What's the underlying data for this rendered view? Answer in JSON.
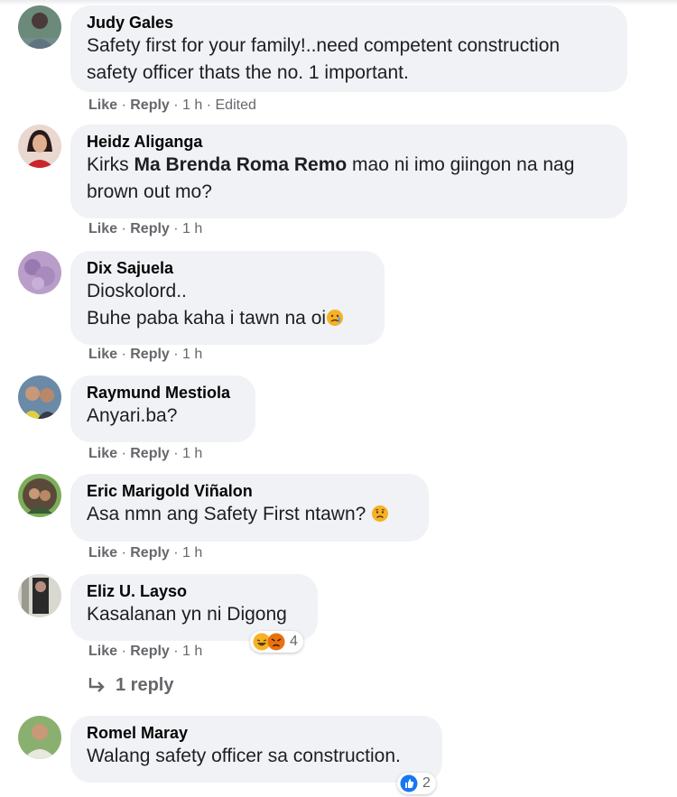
{
  "comments": [
    {
      "name": "Judy Gales",
      "text_lines": [
        "Safety first for your family!..need competent construction",
        "safety officer thats the no. 1 important."
      ],
      "like": "Like",
      "reply": "Reply",
      "time": "1 h",
      "edited": "Edited"
    },
    {
      "name": "Heidz Aliganga",
      "text_pre": "Kirks ",
      "mention": "Ma Brenda Roma Remo",
      "text_post": " mao ni imo giingon na nag",
      "text_line2": "brown out mo?",
      "like": "Like",
      "reply": "Reply",
      "time": "1 h"
    },
    {
      "name": "Dix Sajuela",
      "text_lines": [
        "Dioskolord..",
        "Buhe paba kaha i tawn na oi"
      ],
      "emoji": "crying-face",
      "like": "Like",
      "reply": "Reply",
      "time": "1 h"
    },
    {
      "name": "Raymund Mestiola",
      "text_lines": [
        "Anyari.ba?"
      ],
      "like": "Like",
      "reply": "Reply",
      "time": "1 h"
    },
    {
      "name": "Eric Marigold Viñalon",
      "text_lines": [
        "Asa nmn ang Safety First ntawn?"
      ],
      "emoji": "sad-face",
      "like": "Like",
      "reply": "Reply",
      "time": "1 h"
    },
    {
      "name": "Eliz U. Layso",
      "text_lines": [
        "Kasalanan yn ni Digong"
      ],
      "like": "Like",
      "reply": "Reply",
      "time": "1 h",
      "reactions": {
        "types": [
          "haha",
          "angry"
        ],
        "count": "4"
      }
    },
    {
      "name": "Romel Maray",
      "text_lines": [
        "Walang safety officer sa construction."
      ],
      "reactions": {
        "types": [
          "like"
        ],
        "count": "2"
      }
    }
  ],
  "replies_link": {
    "icon": "reply-arrow-icon",
    "label": "1 reply"
  },
  "colors": {
    "bubble": "#f0f2f5",
    "meta": "#65676b",
    "like_blue": "#1877f2",
    "haha_yellow": "#f7b125",
    "angry_orange": "#e9710f"
  }
}
